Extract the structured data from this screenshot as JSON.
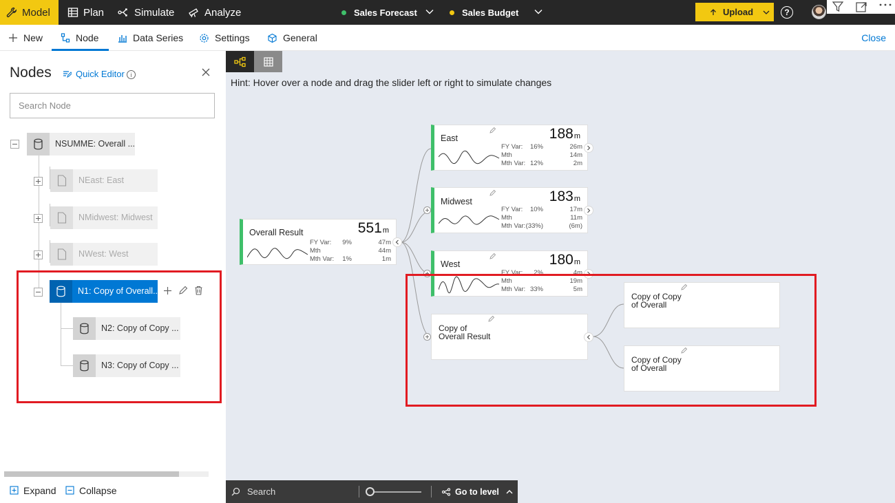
{
  "topbar": {
    "tabs": [
      {
        "label": "Model",
        "icon": "wrench-icon",
        "active": true
      },
      {
        "label": "Plan",
        "icon": "table-icon"
      },
      {
        "label": "Simulate",
        "icon": "simulate-icon"
      },
      {
        "label": "Analyze",
        "icon": "telescope-icon"
      }
    ],
    "scenarios": [
      {
        "label": "Sales Forecast",
        "color": "#3fbf6a"
      },
      {
        "label": "Sales Budget",
        "color": "#f2c811"
      }
    ],
    "upload_label": "Upload",
    "help_glyph": "?"
  },
  "toolbar": {
    "new_label": "New",
    "node_label": "Node",
    "data_series_label": "Data Series",
    "settings_label": "Settings",
    "general_label": "General",
    "close_label": "Close"
  },
  "left_panel": {
    "title": "Nodes",
    "quick_editor_label": "Quick Editor",
    "search_placeholder": "Search Node",
    "tree": [
      {
        "label": "NSUMME: Overall ...",
        "type": "db",
        "state": "normal"
      },
      {
        "label": "NEast: East",
        "type": "page",
        "state": "dim"
      },
      {
        "label": "NMidwest: Midwest",
        "type": "page",
        "state": "dim"
      },
      {
        "label": "NWest: West",
        "type": "page",
        "state": "dim"
      },
      {
        "label": "N1: Copy of Overall...",
        "type": "db",
        "state": "selected"
      },
      {
        "label": "N2: Copy of Copy ...",
        "type": "db",
        "state": "normal"
      },
      {
        "label": "N3: Copy of Copy ...",
        "type": "db",
        "state": "normal"
      }
    ],
    "expand_label": "Expand",
    "collapse_label": "Collapse"
  },
  "canvas": {
    "hint": "Hint: Hover over a node and drag the slider left or right to simulate changes",
    "cards": {
      "overall": {
        "title": "Overall Result",
        "value": "551",
        "unit": "m",
        "rows": [
          {
            "label": "FY Var:",
            "pct": "9%",
            "value": "47m"
          },
          {
            "label": "Mth",
            "pct": "",
            "value": "44m"
          },
          {
            "label": "Mth Var:",
            "pct": "1%",
            "value": "1m"
          }
        ]
      },
      "east": {
        "title": "East",
        "value": "188",
        "unit": "m",
        "rows": [
          {
            "label": "FY Var:",
            "pct": "16%",
            "value": "26m"
          },
          {
            "label": "Mth",
            "pct": "",
            "value": "14m"
          },
          {
            "label": "Mth Var:",
            "pct": "12%",
            "value": "2m"
          }
        ]
      },
      "midwest": {
        "title": "Midwest",
        "value": "183",
        "unit": "m",
        "rows": [
          {
            "label": "FY Var:",
            "pct": "10%",
            "value": "17m"
          },
          {
            "label": "Mth",
            "pct": "",
            "value": "11m"
          },
          {
            "label": "Mth Var:",
            "pct": "(33%)",
            "value": "(6m)"
          }
        ]
      },
      "west": {
        "title": "West",
        "value": "180",
        "unit": "m",
        "rows": [
          {
            "label": "FY Var:",
            "pct": "2%",
            "value": "4m"
          },
          {
            "label": "Mth",
            "pct": "",
            "value": "19m"
          },
          {
            "label": "Mth Var:",
            "pct": "33%",
            "value": "5m"
          }
        ]
      },
      "copy_overall": {
        "line1": "Copy of",
        "line2": "Overall Result"
      },
      "copy_copy_1": {
        "line1": "Copy of Copy",
        "line2": "of Overall"
      },
      "copy_copy_2": {
        "line1": "Copy of Copy",
        "line2": "of Overall"
      }
    },
    "bottom_bar": {
      "search_label": "Search",
      "goto_label": "Go to level"
    }
  },
  "colors": {
    "accent_yellow": "#f2c811",
    "accent_blue": "#0078d4",
    "accent_green": "#3fbf6a",
    "highlight_red": "#e11b22"
  }
}
